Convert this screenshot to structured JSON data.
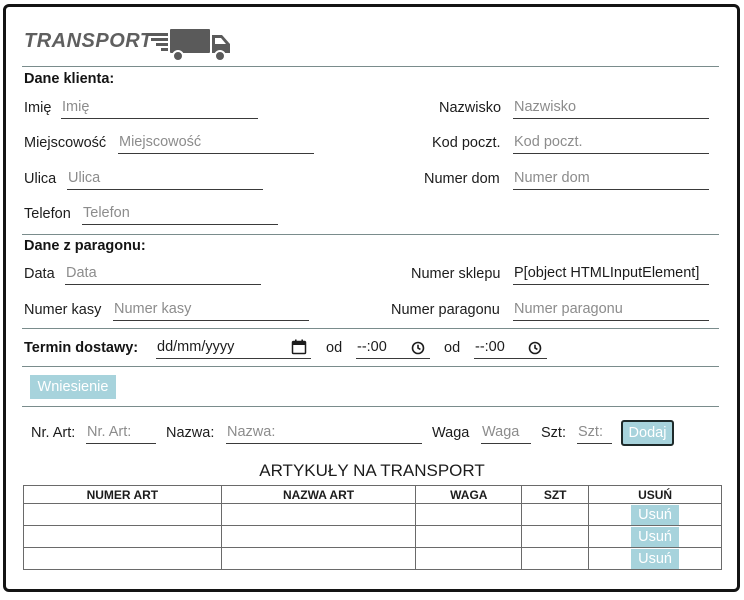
{
  "header": {
    "brand": "TRANSPORT"
  },
  "client": {
    "title": "Dane klienta:",
    "imie": {
      "label": "Imię",
      "placeholder": "Imię"
    },
    "nazwisko": {
      "label": "Nazwisko",
      "placeholder": "Nazwisko"
    },
    "miejscowosc": {
      "label": "Miejscowość",
      "placeholder": "Miejscowość"
    },
    "kod": {
      "label": "Kod poczt.",
      "placeholder": "Kod poczt."
    },
    "ulica": {
      "label": "Ulica",
      "placeholder": "Ulica"
    },
    "numer_dom": {
      "label": "Numer dom",
      "placeholder": "Numer dom"
    },
    "telefon": {
      "label": "Telefon",
      "placeholder": "Telefon"
    }
  },
  "receipt": {
    "title": "Dane z paragonu:",
    "data": {
      "label": "Data",
      "placeholder": "Data"
    },
    "numer_sklepu": {
      "label": "Numer sklepu",
      "value": "P[object HTMLInputElement]"
    },
    "numer_kasy": {
      "label": "Numer kasy",
      "placeholder": "Numer kasy"
    },
    "numer_paragonu": {
      "label": "Numer paragonu",
      "placeholder": "Numer paragonu"
    }
  },
  "delivery": {
    "label": "Termin dostawy:",
    "date_value": "dd/mm/yyyy",
    "od1": "od",
    "time1": "--:00",
    "od2": "od",
    "time2": "--:00"
  },
  "buttons": {
    "wniesienie": "Wniesienie",
    "dodaj": "Dodaj",
    "usun": "Usuń"
  },
  "article": {
    "nr_art": {
      "label": "Nr. Art:",
      "placeholder": "Nr. Art:"
    },
    "nazwa": {
      "label": "Nazwa:",
      "placeholder": "Nazwa:"
    },
    "waga": {
      "label": "Waga",
      "placeholder": "Waga"
    },
    "szt": {
      "label": "Szt:",
      "placeholder": "Szt:"
    }
  },
  "table": {
    "title": "ARTYKUŁY NA TRANSPORT",
    "columns": [
      "NUMER ART",
      "NAZWA ART",
      "WAGA",
      "SZT",
      "USUŃ"
    ]
  },
  "colors": {
    "accent": "#a7d3dc",
    "border": "#141414",
    "placeholder": "#8c8c8c"
  }
}
